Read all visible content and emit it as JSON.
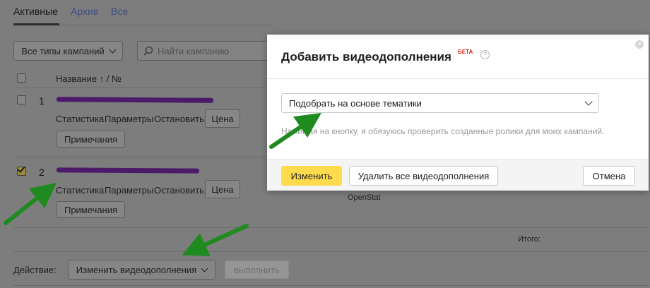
{
  "tabs": {
    "active": "Активные",
    "archive": "Архив",
    "all": "Все"
  },
  "toolbar": {
    "campaign_types_label": "Все типы кампаний",
    "search_placeholder": "Найти кампанию"
  },
  "table": {
    "header_name": "Название ↑ / №",
    "rows": [
      {
        "index": "1",
        "links": [
          "Статистика",
          "Параметры",
          "Остановить"
        ],
        "price_label": "Цена",
        "notes_label": "Примечания",
        "checked": false
      },
      {
        "index": "2",
        "links": [
          "Статистика",
          "Параметры",
          "Остановить"
        ],
        "price_label": "Цена",
        "notes_label": "Примечания",
        "checked": true,
        "extra": "OpenStat"
      }
    ],
    "total_label": "Итого:"
  },
  "bottom": {
    "action_label": "Действие:",
    "action_select": "Изменить видеодополнения",
    "execute_label": "выполнить"
  },
  "modal": {
    "title": "Добавить видеодополнения",
    "beta": "БЕТА",
    "help": "?",
    "close": "×",
    "select_value": "Подобрать на основе тематики",
    "note": "Нажимая на кнопку, я обязуюсь проверить созданные ролики для моих кампаний.",
    "apply_label": "Изменить",
    "delete_all_label": "Удалить все видеодополнения",
    "cancel_label": "Отмена"
  },
  "colors": {
    "accent_yellow": "#ffdb4d",
    "arrow_green": "#1f8a1f",
    "redaction_purple": "#4c1a6b"
  }
}
